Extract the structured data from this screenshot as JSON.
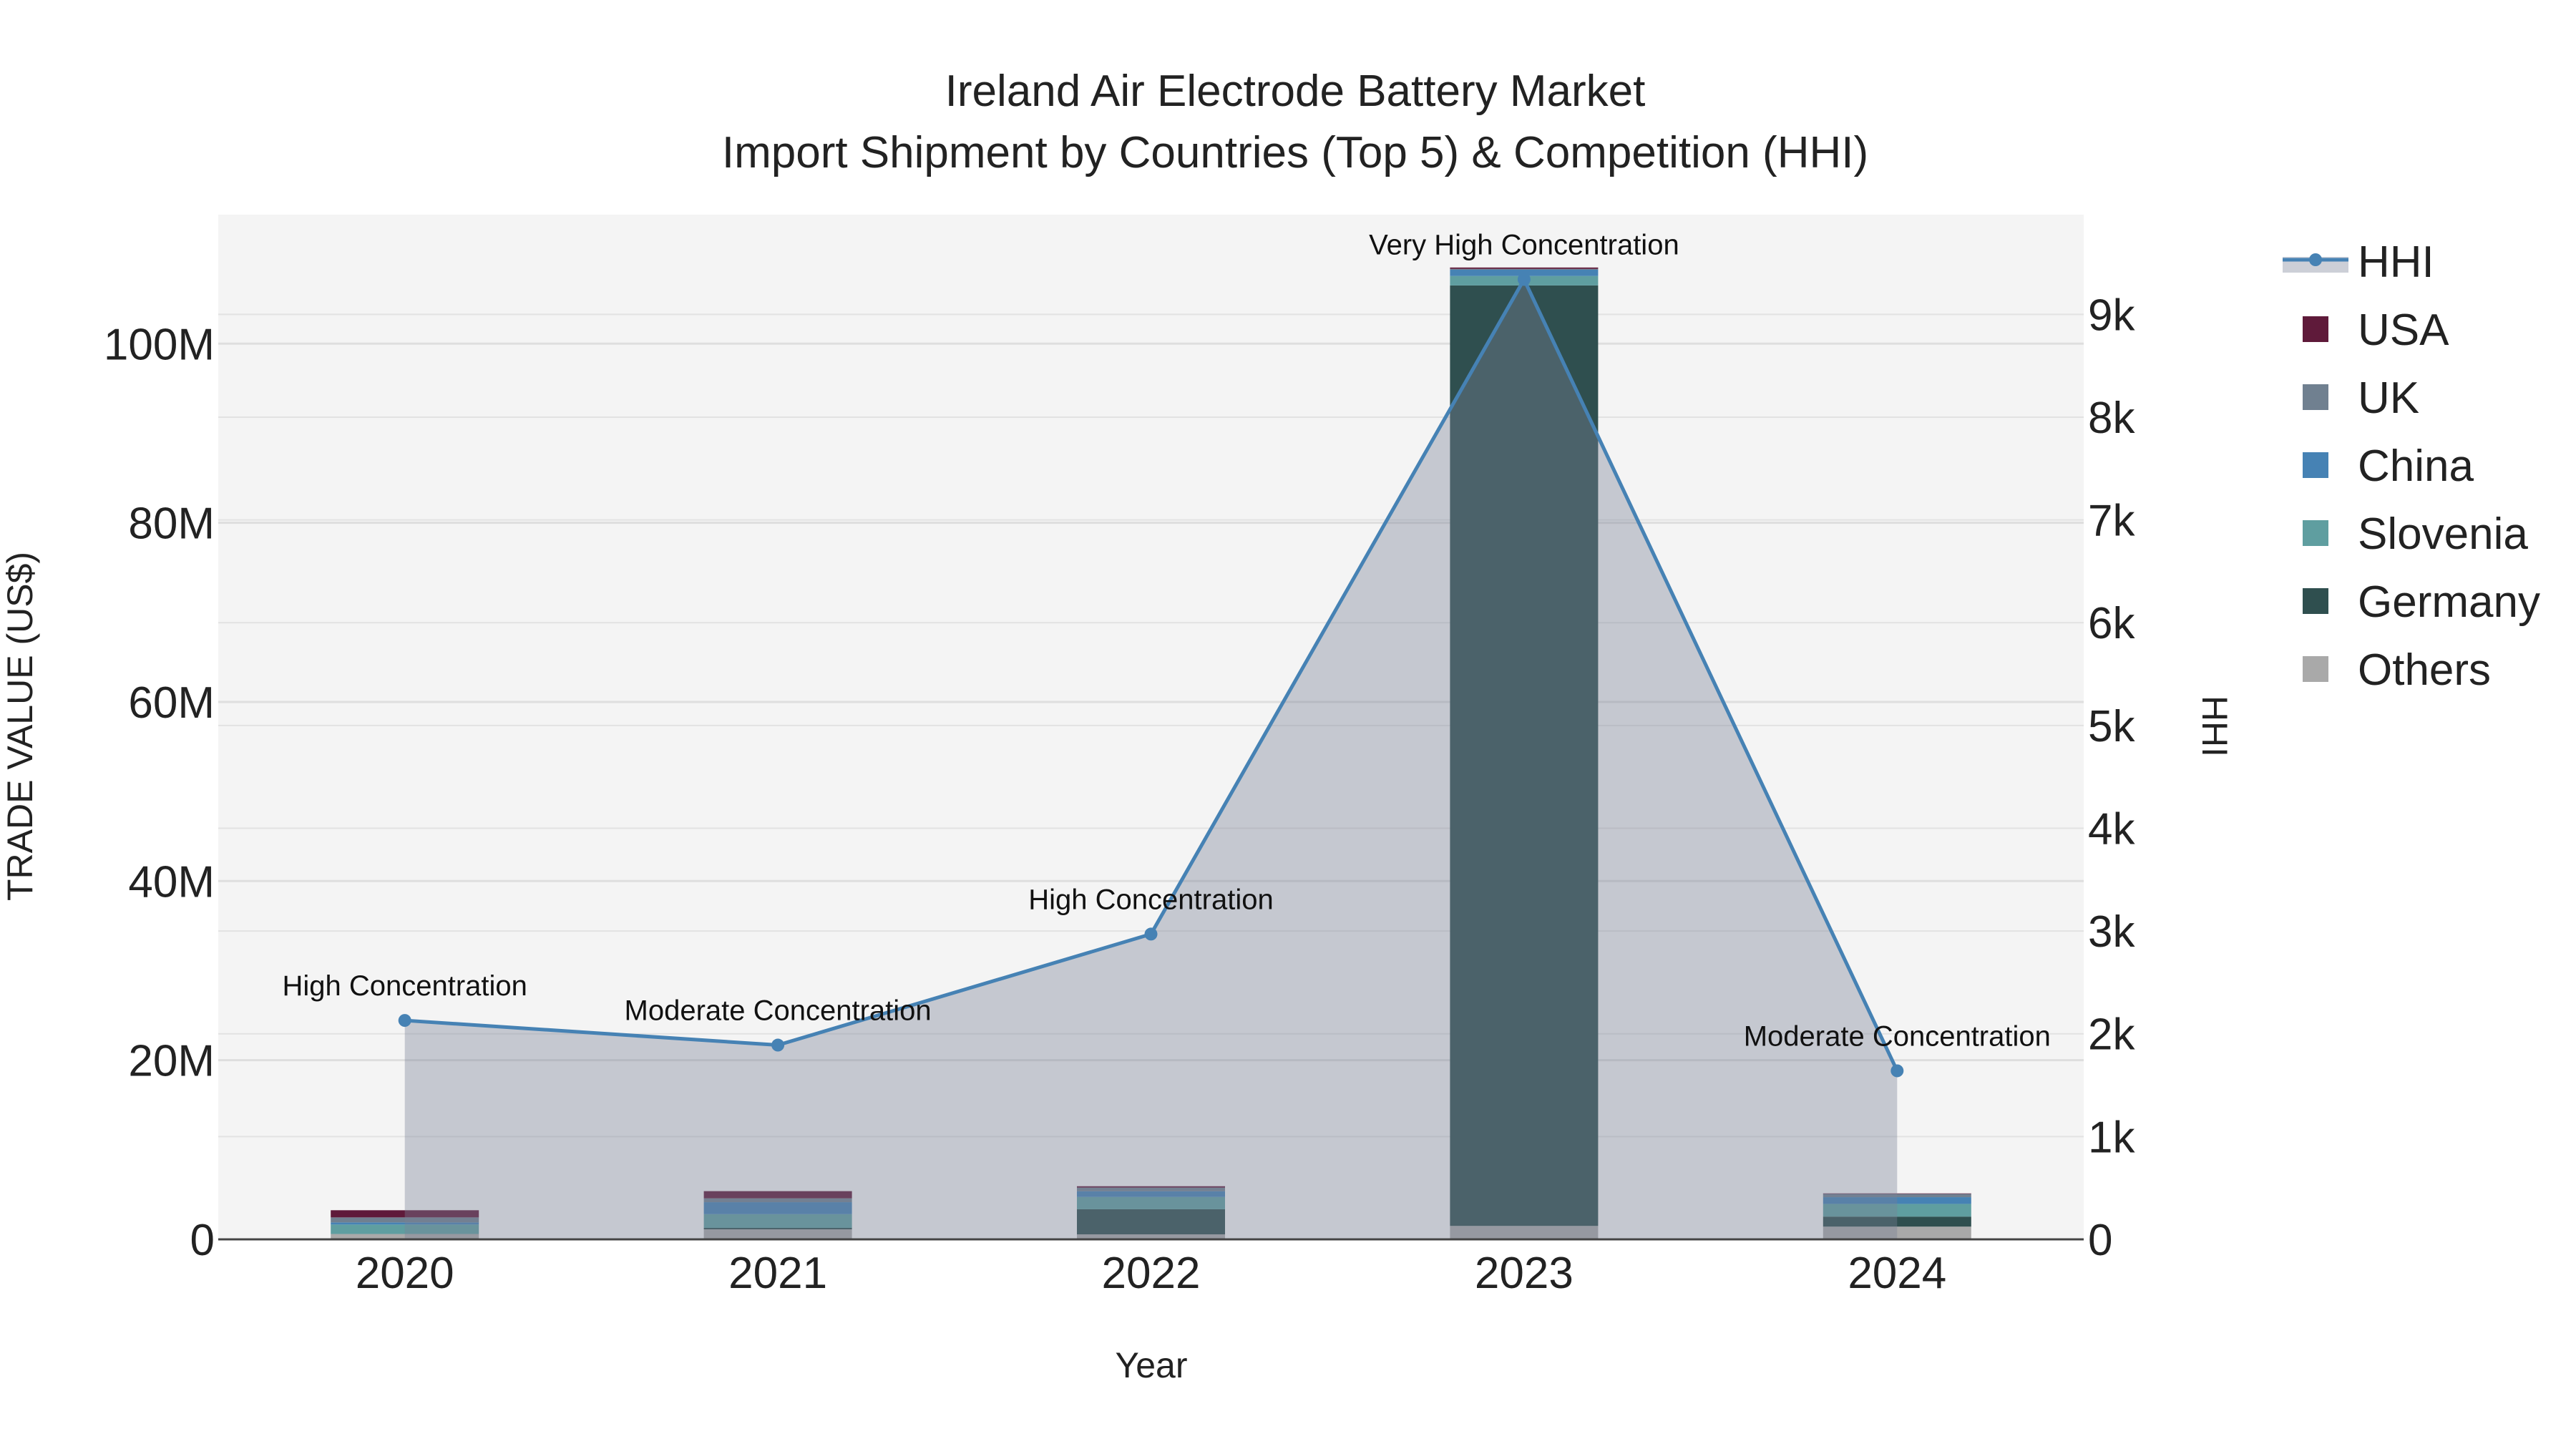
{
  "chart_data": {
    "type": "bar",
    "title": "Ireland Air Electrode Battery Market",
    "subtitle": "Import Shipment by Countries (Top 5) & Competition (HHI)",
    "xlabel": "Year",
    "ylabel": "TRADE VALUE (US$)",
    "y2label": "HHI",
    "categories": [
      "2020",
      "2021",
      "2022",
      "2023",
      "2024"
    ],
    "ylim": [
      0,
      114.4
    ],
    "y_unit": "M",
    "y_ticks": [
      0,
      20,
      40,
      60,
      80,
      100
    ],
    "y_tick_labels": [
      "0",
      "20M",
      "40M",
      "60M",
      "80M",
      "100M"
    ],
    "y2lim": [
      0,
      9.97
    ],
    "y2_ticks": [
      0,
      1,
      2,
      3,
      4,
      5,
      6,
      7,
      8,
      9
    ],
    "y2_tick_labels": [
      "0",
      "1k",
      "2k",
      "3k",
      "4k",
      "5k",
      "6k",
      "7k",
      "8k",
      "9k"
    ],
    "legend_position": "right",
    "series": [
      {
        "name": "Others",
        "color": "#a9a9a9",
        "values": [
          0.6,
          1.12,
          0.56,
          1.5,
          1.42
        ]
      },
      {
        "name": "Germany",
        "color": "#2f4f4f",
        "values": [
          0.0,
          0.16,
          2.8,
          105.0,
          1.12
        ]
      },
      {
        "name": "Slovenia",
        "color": "#5f9ea0",
        "values": [
          1.05,
          1.53,
          1.37,
          1.05,
          1.42
        ]
      },
      {
        "name": "China",
        "color": "#4682b4",
        "values": [
          0.24,
          1.34,
          0.64,
          0.7,
          0.75
        ]
      },
      {
        "name": "UK",
        "color": "#708090",
        "values": [
          0.56,
          0.43,
          0.4,
          0.1,
          0.37
        ]
      },
      {
        "name": "USA",
        "color": "#5f1a3a",
        "values": [
          0.8,
          0.8,
          0.16,
          0.15,
          0.05
        ]
      }
    ],
    "hhi": {
      "name": "HHI",
      "color": "#4682b4",
      "values_k": [
        2.13,
        1.89,
        2.97,
        9.34,
        1.64
      ],
      "annotations": [
        "High Concentration",
        "Moderate Concentration",
        "High Concentration",
        "Very High Concentration",
        "Moderate Concentration"
      ]
    },
    "legend_order": [
      "HHI",
      "USA",
      "UK",
      "China",
      "Slovenia",
      "Germany",
      "Others"
    ]
  }
}
